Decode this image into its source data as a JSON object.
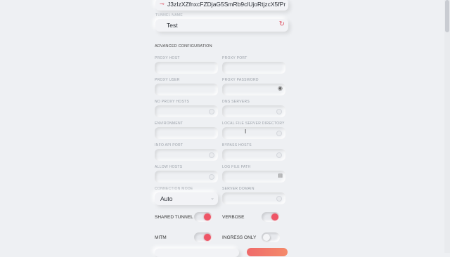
{
  "top_field": {
    "icon": "key-icon",
    "value": "J3zIzXZfnxcFZDjaG5SmRb9clUjoRtjzcX5fPr"
  },
  "tunnel_name": {
    "label": "TUNNEL NAME",
    "value": "Test"
  },
  "advanced": {
    "title": "ADVANCED CONFIGURATION"
  },
  "fields": {
    "proxy_host": "PROXY HOST",
    "proxy_port": "PROXY PORT",
    "proxy_user": "PROXY USER",
    "proxy_password": "PROXY PASSWORD",
    "no_proxy_hosts": "NO PROXY HOSTS",
    "dns_servers": "DNS SERVERS",
    "environment": "ENVIRONMENT",
    "local_file_server_directory": "LOCAL FILE SERVER DIRECTORY",
    "info_api_port": "INFO API PORT",
    "bypass_hosts": "BYPASS HOSTS",
    "allow_hosts": "ALLOW HOSTS",
    "log_file_path": "LOG FILE PATH",
    "connection_mode": "CONNECTION MODE",
    "server_domain": "SERVER DOMAIN"
  },
  "connection_mode_value": "Auto",
  "toggles": {
    "shared_tunnel": {
      "label": "SHARED TUNNEL",
      "on": true
    },
    "verbose": {
      "label": "VERBOSE",
      "on": true
    },
    "mitm": {
      "label": "MITM",
      "on": true
    },
    "ingress_only": {
      "label": "INGRESS ONLY",
      "on": false
    }
  },
  "colors": {
    "accent": "#ee5566",
    "background": "#eef0f3"
  }
}
